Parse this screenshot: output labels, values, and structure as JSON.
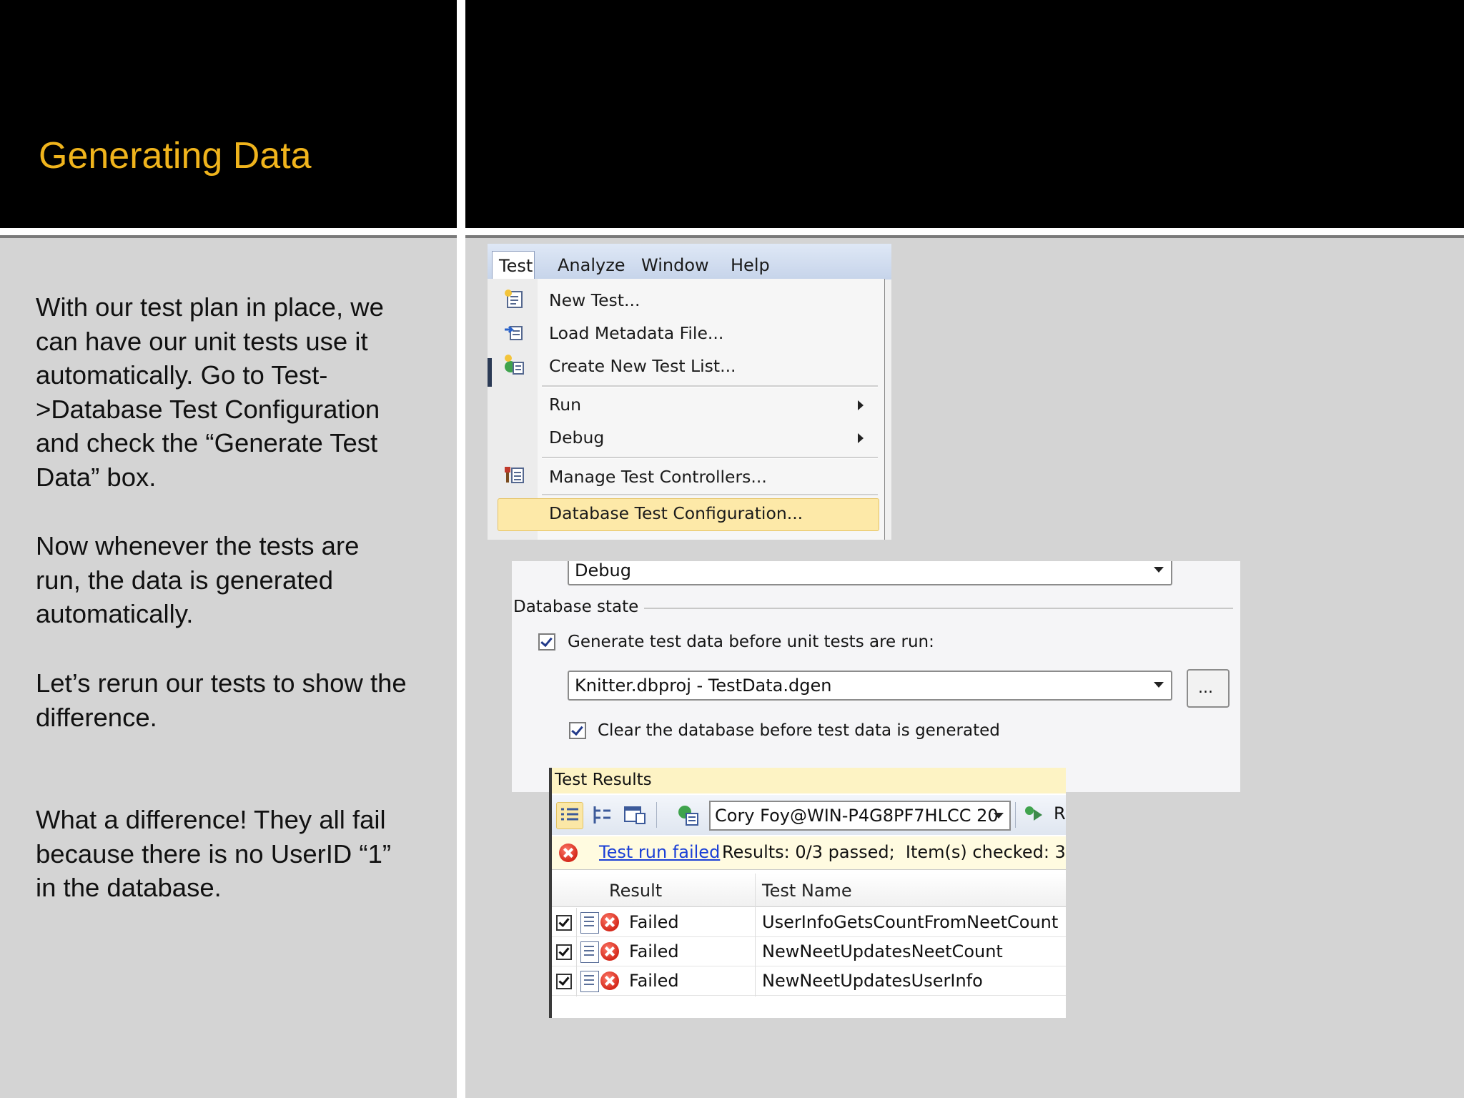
{
  "slide": {
    "title": "Generating Data",
    "paragraphs": [
      "With our test plan in place, we can have our unit tests use it automatically. Go to Test->Database Test Configuration and check the “Generate Test Data” box.",
      "Now whenever the tests are run, the data is generated automatically.",
      "Let’s rerun our tests to show the difference.",
      "What a difference! They all fail because there is no UserID “1” in the database."
    ],
    "colors": {
      "title": "#f0b41c",
      "header_bg": "#000000",
      "body_bg": "#d4d4d4"
    }
  },
  "menu": {
    "bar": [
      "Test",
      "Analyze",
      "Window",
      "Help"
    ],
    "items": [
      {
        "label": "New Test...",
        "icon": "new-test-icon"
      },
      {
        "label": "Load Metadata File...",
        "icon": "load-metadata-icon"
      },
      {
        "label": "Create New Test List...",
        "icon": "new-test-list-icon"
      },
      {
        "label": "Run",
        "submenu": true
      },
      {
        "label": "Debug",
        "submenu": true
      },
      {
        "label": "Manage Test Controllers...",
        "icon": "test-controllers-icon"
      },
      {
        "label": "Database Test Configuration...",
        "highlighted": true
      }
    ]
  },
  "db_config": {
    "configuration_value": "Debug",
    "section_label": "Database state",
    "generate_label": "Generate test data before unit tests are run:",
    "generate_checked": true,
    "plan_value": "Knitter.dbproj - TestData.dgen",
    "browse_label": "...",
    "clear_label": "Clear the database before test data is generated",
    "clear_checked": true
  },
  "test_results": {
    "title": "Test Results",
    "run_user": "Cory Foy@WIN-P4G8PF7HLCC 20",
    "run_button_partial": "R",
    "status_link": "Test run failed",
    "status_summary": "Results: 0/3 passed;  Item(s) checked: 3",
    "columns": [
      "Result",
      "Test Name"
    ],
    "rows": [
      {
        "result": "Failed",
        "name": "UserInfoGetsCountFromNeetCount"
      },
      {
        "result": "Failed",
        "name": "NewNeetUpdatesNeetCount"
      },
      {
        "result": "Failed",
        "name": "NewNeetUpdatesUserInfo"
      }
    ]
  }
}
